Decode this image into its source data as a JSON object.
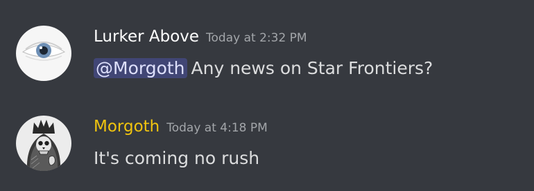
{
  "messages": [
    {
      "author": "Lurker Above",
      "timestamp": "Today at 2:32 PM",
      "mention": "@Morgoth",
      "text": "Any news on Star Frontiers?",
      "avatar_icon": "eye-icon"
    },
    {
      "author": "Morgoth",
      "timestamp": "Today at 4:18 PM",
      "text": "It's coming no rush",
      "avatar_icon": "crowned-skull-icon",
      "author_color": "#f1c40f"
    }
  ],
  "colors": {
    "background": "#36393f",
    "mention_bg": "#414675",
    "mention_text": "#dee0fc",
    "timestamp": "#a3a6aa",
    "message_text": "#dcddde"
  }
}
